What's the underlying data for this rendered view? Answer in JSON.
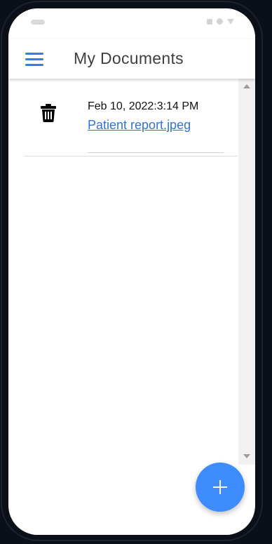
{
  "app": {
    "title": "My Documents"
  },
  "documents": [
    {
      "date": "Feb 10, 2022:3:14 PM",
      "name": "Patient report.jpeg"
    }
  ],
  "colors": {
    "accent": "#2f80ed",
    "fab": "#3d8bfd",
    "link": "#2f73d9"
  },
  "icons": {
    "menu": "menu-icon",
    "delete": "trash-icon",
    "add": "plus-icon"
  }
}
